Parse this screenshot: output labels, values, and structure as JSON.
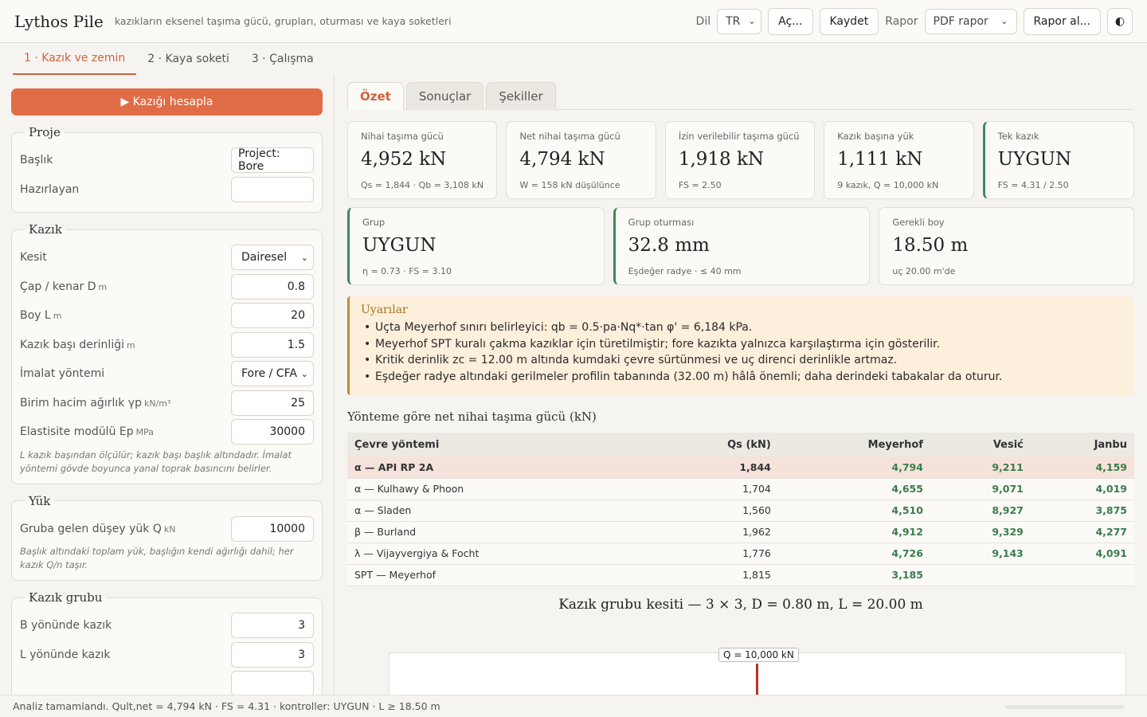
{
  "header": {
    "title": "Lythos Pile",
    "subtitle": "kazıkların eksenel taşıma gücü, grupları, oturması ve kaya soketleri",
    "lang_label": "Dil",
    "lang_value": "TR",
    "open_label": "Aç...",
    "save_label": "Kaydet",
    "report_label": "Rapor",
    "report_format": "PDF rapor",
    "get_report_label": "Rapor al...",
    "theme_icon": "◐"
  },
  "steps": [
    "1 · Kazık ve zemin",
    "2 · Kaya soketi",
    "3 · Çalışma"
  ],
  "left": {
    "calc_button": "▶ Kazığı hesapla",
    "project": {
      "legend": "Proje",
      "title_label": "Başlık",
      "title_value": "Project: Bore",
      "prepared_label": "Hazırlayan",
      "prepared_value": ""
    },
    "pile": {
      "legend": "Kazık",
      "section_label": "Kesit",
      "section_value": "Dairesel",
      "diameter_label": "Çap / kenar D",
      "diameter_unit": "m",
      "diameter_value": "0.8",
      "length_label": "Boy L",
      "length_unit": "m",
      "length_value": "20",
      "head_depth_label": "Kazık başı derinliği",
      "head_depth_unit": "m",
      "head_depth_value": "1.5",
      "method_label": "İmalat yöntemi",
      "method_value": "Fore / CFA",
      "unit_weight_label": "Birim hacim ağırlık γp",
      "unit_weight_unit": "kN/m³",
      "unit_weight_value": "25",
      "modulus_label": "Elastisite modülü Ep",
      "modulus_unit": "MPa",
      "modulus_value": "30000",
      "note": "L kazık başından ölçülür; kazık başı başlık altındadır. İmalat yöntemi gövde boyunca yanal toprak basıncını belirler."
    },
    "load": {
      "legend": "Yük",
      "q_label": "Gruba gelen düşey yük Q",
      "q_unit": "kN",
      "q_value": "10000",
      "note": "Başlık altındaki toplam yük, başlığın kendi ağırlığı dahil; her kazık Q/n taşır."
    },
    "group": {
      "legend": "Kazık grubu",
      "nb_label": "B yönünde kazık",
      "nb_value": "3",
      "nl_label": "L yönünde kazık",
      "nl_value": "3"
    }
  },
  "right": {
    "tabs": [
      "Özet",
      "Sonuçlar",
      "Şekiller"
    ],
    "cards_row1": [
      {
        "title": "Nihai taşıma gücü",
        "value": "4,952 kN",
        "sub": "Qs = 1,844 · Qb = 3,108 kN"
      },
      {
        "title": "Net nihai taşıma gücü",
        "value": "4,794 kN",
        "sub": "W = 158 kN düşülünce"
      },
      {
        "title": "İzin verilebilir taşıma gücü",
        "value": "1,918 kN",
        "sub": "FS = 2.50"
      },
      {
        "title": "Kazık başına yük",
        "value": "1,111 kN",
        "sub": "9 kazık, Q = 10,000 kN"
      },
      {
        "title": "Tek kazık",
        "value": "UYGUN",
        "sub": "FS = 4.31 / 2.50"
      }
    ],
    "cards_row2": [
      {
        "title": "Grup",
        "value": "UYGUN",
        "sub": "η = 0.73 · FS = 3.10"
      },
      {
        "title": "Grup oturması",
        "value": "32.8 mm",
        "sub": "Eşdeğer radye · ≤ 40 mm"
      },
      {
        "title": "Gerekli boy",
        "value": "18.50 m",
        "sub": "uç 20.00 m'de"
      }
    ],
    "status_color": "#3f8a57",
    "warnings": {
      "title": "Uyarılar",
      "items": [
        "Uçta Meyerhof sınırı belirleyici: qb = 0.5·pa·Nq*·tan φ' = 6,184 kPa.",
        "Meyerhof SPT kuralı çakma kazıklar için türetilmiştir; fore kazıkta yalnızca karşılaştırma için gösterilir.",
        "Kritik derinlik zc = 12.00 m altında kumdaki çevre sürtünmesi ve uç direnci derinlikle artmaz.",
        "Eşdeğer radye altındaki gerilmeler profilin tabanında (32.00 m) hâlâ önemli; daha derindeki tabakalar da oturur."
      ]
    },
    "table": {
      "title": "Yönteme göre net nihai taşıma gücü (kN)",
      "headers": [
        "Çevre yöntemi",
        "Qs (kN)",
        "Meyerhof",
        "Vesić",
        "Janbu"
      ],
      "rows": [
        [
          "α — API RP 2A",
          "1,844",
          "4,794",
          "9,211",
          "4,159"
        ],
        [
          "α — Kulhawy & Phoon",
          "1,704",
          "4,655",
          "9,071",
          "4,019"
        ],
        [
          "α — Sladen",
          "1,560",
          "4,510",
          "8,927",
          "3,875"
        ],
        [
          "β — Burland",
          "1,962",
          "4,912",
          "9,329",
          "4,277"
        ],
        [
          "λ — Vijayvergiya & Focht",
          "1,776",
          "4,726",
          "9,143",
          "4,091"
        ],
        [
          "SPT — Meyerhof",
          "1,815",
          "3,185",
          "",
          ""
        ]
      ]
    },
    "figure": {
      "title": "Kazık grubu kesiti — 3 × 3, D = 0.80 m, L = 20.00 m",
      "q_label": "Q = 10,000 kN"
    }
  },
  "status": "Analiz tamamlandı. Qult,net = 4,794 kN · FS = 4.31 · kontroller: UYGUN · L ≥ 18.50 m"
}
